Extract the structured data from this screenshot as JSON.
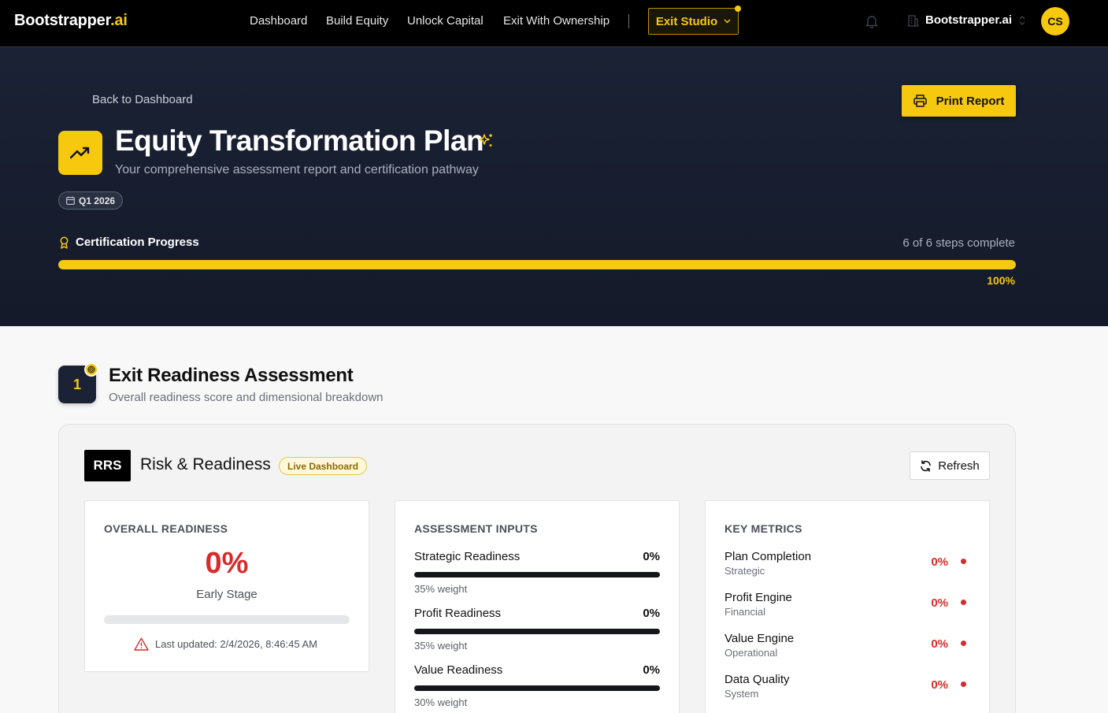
{
  "nav": {
    "brand": "Bootstrapper",
    "brand_suffix": ".ai",
    "links": [
      "Dashboard",
      "Build Equity",
      "Unlock Capital",
      "Exit With Ownership"
    ],
    "studio_label": "Exit Studio",
    "org_name": "Bootstrapper.ai",
    "avatar_initials": "CS"
  },
  "hero": {
    "back_label": "Back to Dashboard",
    "print_label": "Print Report",
    "title": "Equity Transformation Plan",
    "subtitle": "Your comprehensive assessment report and certification pathway",
    "quarter": "Q1 2026",
    "cert_label": "Certification Progress",
    "cert_steps": "6 of 6 steps complete",
    "progress": 1.0,
    "progress_label": "100%"
  },
  "section": {
    "number": "1",
    "title": "Exit Readiness Assessment",
    "subtitle": "Overall readiness score and dimensional breakdown"
  },
  "panel": {
    "badge": "RRS",
    "title": "Risk & Readiness",
    "live_label": "Live Dashboard",
    "refresh_label": "Refresh"
  },
  "overall": {
    "heading": "OVERALL READINESS",
    "value": "0%",
    "stage": "Early Stage",
    "progress": 0,
    "updated": "Last updated: 2/4/2026, 8:46:45 AM"
  },
  "inputs": {
    "heading": "ASSESSMENT INPUTS",
    "items": [
      {
        "label": "Strategic Readiness",
        "value": "0%",
        "weight": "35% weight"
      },
      {
        "label": "Profit Readiness",
        "value": "0%",
        "weight": "35% weight"
      },
      {
        "label": "Value Readiness",
        "value": "0%",
        "weight": "30% weight"
      }
    ]
  },
  "metrics": {
    "heading": "KEY METRICS",
    "items": [
      {
        "name": "Plan Completion",
        "category": "Strategic",
        "value": "0%"
      },
      {
        "name": "Profit Engine",
        "category": "Financial",
        "value": "0%"
      },
      {
        "name": "Value Engine",
        "category": "Operational",
        "value": "0%"
      },
      {
        "name": "Data Quality",
        "category": "System",
        "value": "0%"
      }
    ]
  },
  "colors": {
    "accent": "#f6c90e",
    "danger": "#d92b2b",
    "hero_bg": "#1b2235"
  }
}
